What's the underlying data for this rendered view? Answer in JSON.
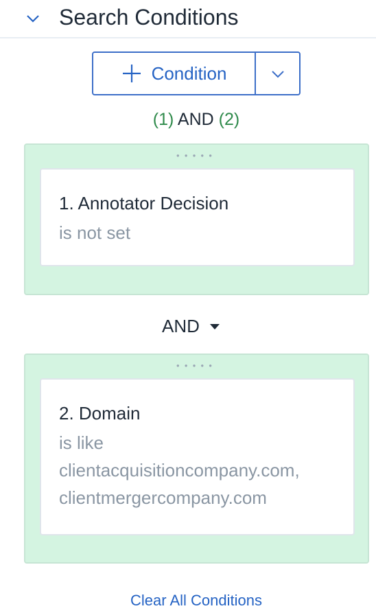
{
  "header": {
    "title": "Search Conditions",
    "collapse_icon": "chevron-down-icon"
  },
  "add_button": {
    "icon": "plus-icon",
    "label": "Condition",
    "menu_icon": "chevron-down-icon"
  },
  "logic": {
    "open1": "(1)",
    "op": "AND",
    "open2": "(2)"
  },
  "conditions": [
    {
      "title": "1. Annotator Decision",
      "description": "is not set"
    },
    {
      "title": "2. Domain",
      "description_lines": [
        "is like",
        "clientacquisitioncompany.com,",
        "clientmergercompany.com"
      ]
    }
  ],
  "operator": {
    "label": "AND",
    "icon": "caret-down-icon"
  },
  "clear_all": "Clear All Conditions",
  "colors": {
    "accent": "#2563c4",
    "logic_number": "#2f8a4b",
    "condition_bg": "#d4f4e1",
    "muted_text": "#8a96a3"
  }
}
